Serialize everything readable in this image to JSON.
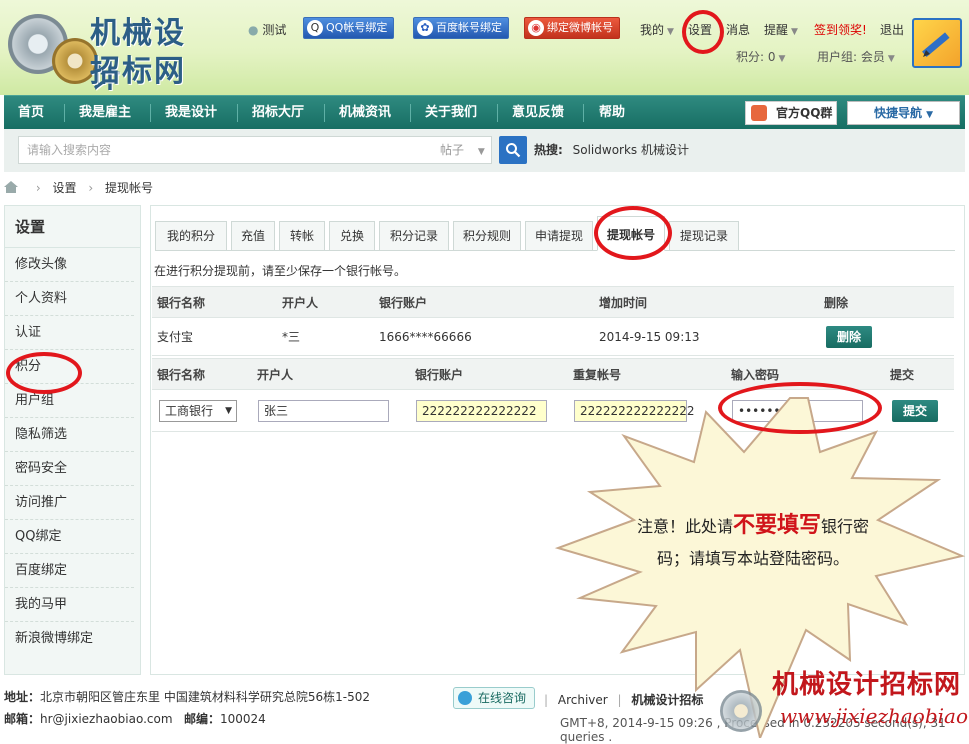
{
  "logo": {
    "line1": "机械设计",
    "line2": "招标网"
  },
  "topbar": {
    "user": "测试",
    "qq_bind": "QQ帐号绑定",
    "baidu_bind": "百度帐号绑定",
    "weibo_bind": "绑定微博帐号",
    "links": [
      "我的",
      "设置",
      "消息",
      "提醒",
      "签到领奖!",
      "退出"
    ],
    "points": "积分: 0",
    "usergroup": "用户组: 会员"
  },
  "nav": {
    "items": [
      "首页",
      "我是雇主",
      "我是设计",
      "招标大厅",
      "机械资讯",
      "关于我们",
      "意见反馈",
      "帮助"
    ],
    "qq_group": "官方QQ群",
    "quick_nav": "快捷导航"
  },
  "search": {
    "placeholder": "请输入搜索内容",
    "type": "帖子",
    "hot_label": "热搜:",
    "hot_items": "Solidworks  机械设计"
  },
  "breadcrumb": {
    "items": [
      "设置",
      "提现帐号"
    ]
  },
  "sidebar": {
    "title": "设置",
    "items": [
      "修改头像",
      "个人资料",
      "认证",
      "积分",
      "用户组",
      "隐私筛选",
      "密码安全",
      "访问推广",
      "QQ绑定",
      "百度绑定",
      "我的马甲",
      "新浪微博绑定"
    ]
  },
  "tabs": [
    "我的积分",
    "充值",
    "转帐",
    "兑换",
    "积分记录",
    "积分规则",
    "申请提现",
    "提现帐号",
    "提现记录"
  ],
  "notice": "在进行积分提现前，请至少保存一个银行帐号。",
  "accounts_table": {
    "headers": [
      "银行名称",
      "开户人",
      "银行账户",
      "增加时间",
      "删除"
    ],
    "rows": [
      {
        "bank": "支付宝",
        "holder": "*三",
        "account": "1666****66666",
        "time": "2014-9-15 09:13",
        "action": "删除"
      }
    ]
  },
  "add_form": {
    "headers": [
      "银行名称",
      "开户人",
      "银行账户",
      "重复帐号",
      "输入密码",
      "提交"
    ],
    "bank_select": "工商银行",
    "holder": "张三",
    "account": "222222222222222",
    "repeat_account": "222222222222222",
    "password": "•••••••••",
    "submit": "提交"
  },
  "callout": {
    "part1": "注意！此处请",
    "emph": "不要填写",
    "part2": "银行密码；请填写本站登陆密码。"
  },
  "footer": {
    "address_label": "地址：",
    "address": "北京市朝阳区管庄东里 中国建筑材料科学研究总院56栋1-502",
    "email_label": "邮箱：",
    "email": "hr@jixiezhaobiao.com",
    "zip_label": "邮编：",
    "zip": "100024",
    "online": "在线咨询",
    "archiver": "Archiver",
    "site": "机械设计招标",
    "time": "GMT+8, 2014-9-15 09:26 , Processed in 0.232205 second(s), 31 queries ."
  },
  "watermark": {
    "line1": "机械设计招标网",
    "line2": "www.jixiezhaobiao.com"
  }
}
